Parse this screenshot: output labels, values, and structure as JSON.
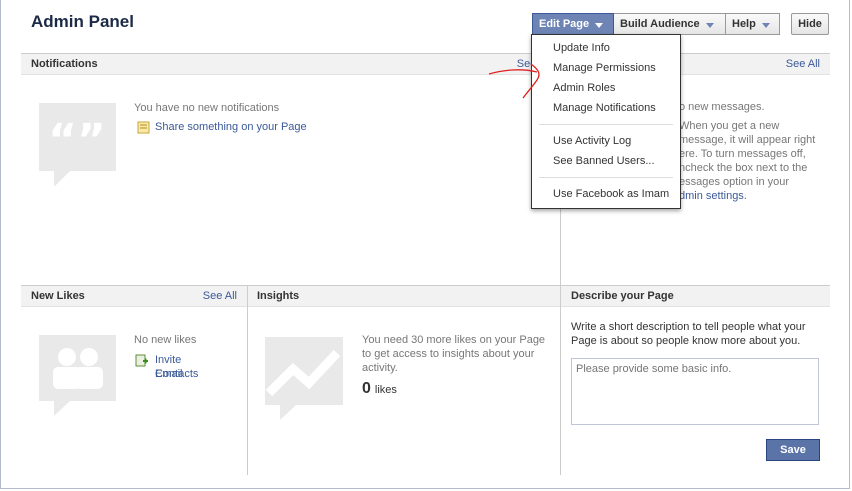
{
  "page_title": "Admin Panel",
  "toolbar": {
    "edit_page": "Edit Page",
    "build_audience": "Build Audience",
    "help": "Help",
    "hide": "Hide"
  },
  "edit_menu": {
    "items": [
      "Update Info",
      "Manage Permissions",
      "Admin Roles",
      "Manage Notifications"
    ],
    "items2": [
      "Use Activity Log",
      "See Banned Users..."
    ],
    "items3": [
      "Use Facebook as Imam"
    ]
  },
  "notifications": {
    "header": "Notifications",
    "see_all": "See All",
    "empty": "You have no new notifications",
    "share_link": "Share something on your Page"
  },
  "messages": {
    "see_all": "See All",
    "line1": "o new messages.",
    "line2": "When you get a new",
    "line3": "message, it will appear right",
    "line4": "ere. To turn messages off,",
    "line5": "ncheck the box next to the",
    "line6": "essages option in your",
    "line7": "dmin settings."
  },
  "new_likes": {
    "header": "New Likes",
    "see_all": "See All",
    "empty": "No new likes",
    "invite1": "Invite Email",
    "invite2": "Contacts"
  },
  "insights": {
    "header": "Insights",
    "line1": "You need 30 more likes on your Page",
    "line2": "to get access to insights about your",
    "line3": "activity.",
    "count": "0",
    "count_label": "likes"
  },
  "describe": {
    "header": "Describe your Page",
    "line1": "Write a short description to tell people what your",
    "line2": "Page is about so people know more about you.",
    "placeholder": "Please provide some basic info.",
    "save": "Save"
  },
  "colors": {
    "link": "#3b5998",
    "button": "#5b74a8"
  }
}
